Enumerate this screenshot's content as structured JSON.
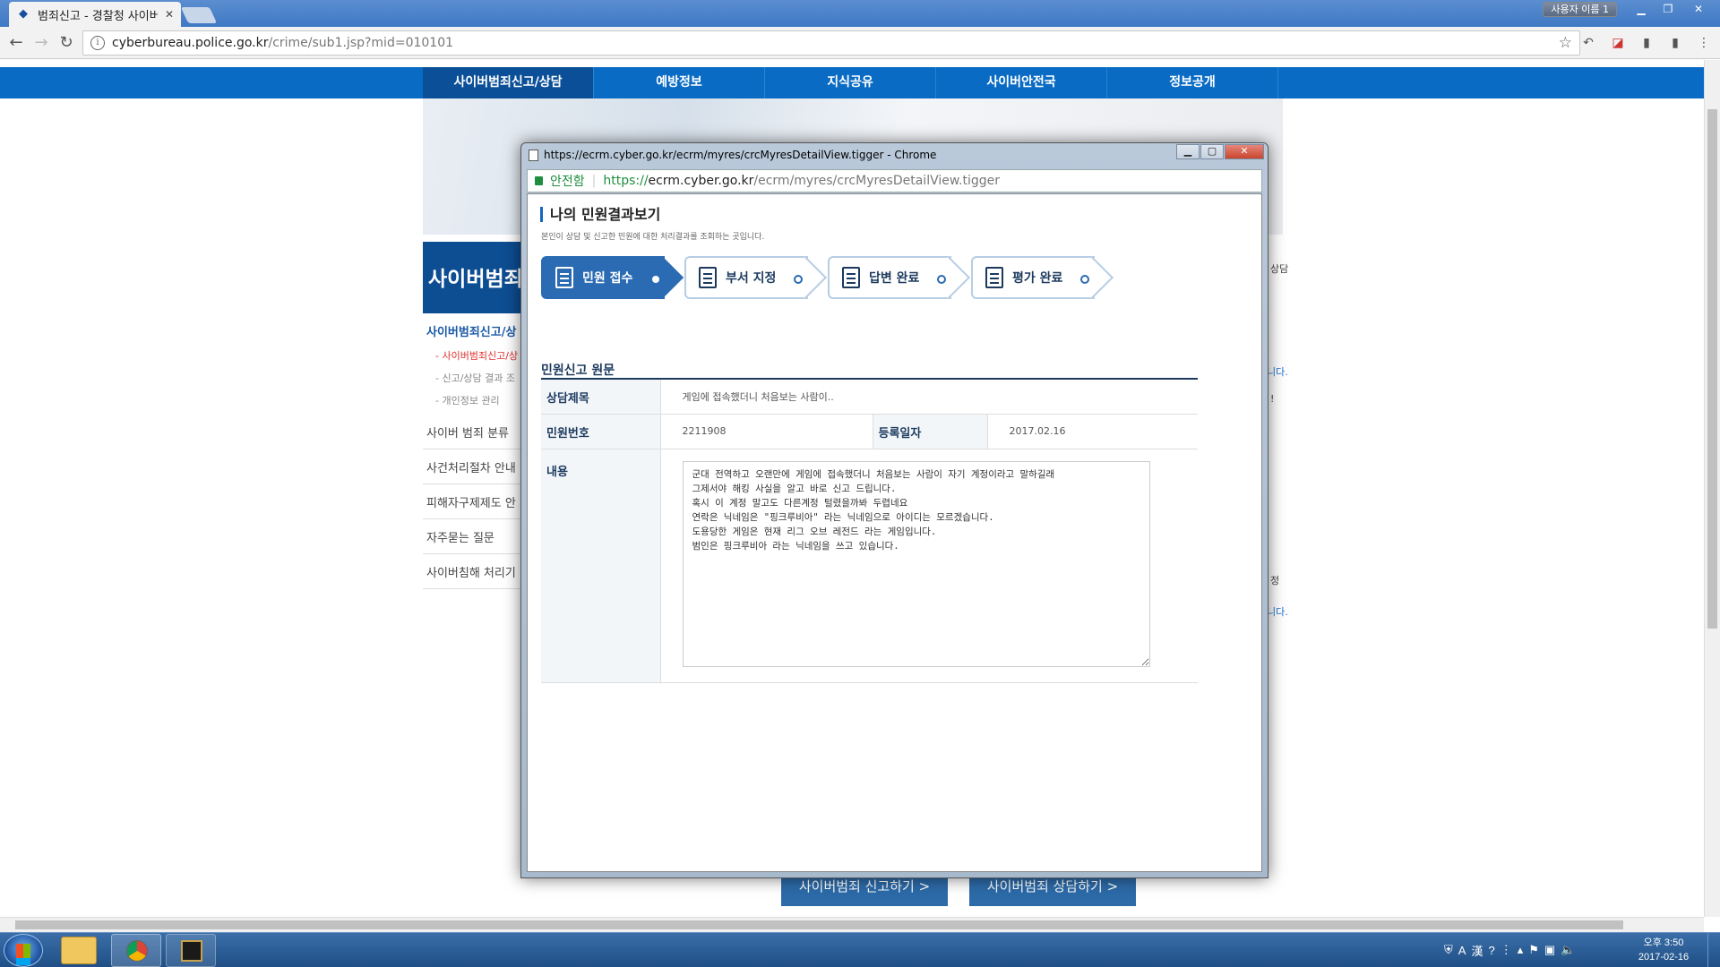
{
  "browser": {
    "tab_title": "범죄신고 - 경찰청 사이버",
    "user_badge": "사용자 이름 1",
    "url_host": "cyberbureau.police.go.kr",
    "url_path": "/crime/sub1.jsp?mid=010101"
  },
  "site": {
    "nav": [
      "사이버범죄신고/상담",
      "예방정보",
      "지식공유",
      "사이버안전국",
      "정보공개"
    ],
    "lnb_title": "사이버범죄",
    "lnb_sub": "사이버범죄신고/상",
    "lnb_links": [
      "- 사이버범죄신고/상",
      "- 신고/상담 결과 조",
      "- 개인정보 관리"
    ],
    "lnb_menu": [
      "사이버 범죄 분류",
      "사건처리절차 안내",
      "피해자구제제도 안",
      "자주묻는 질문",
      "사이버침해 처리기"
    ],
    "right_snips": [
      "상담",
      "니다.",
      "!",
      "정",
      "니다."
    ],
    "bottom_buttons": [
      "사이버범죄 신고하기 >",
      "사이버범죄 상담하기 >"
    ]
  },
  "popup": {
    "window_title": "https://ecrm.cyber.go.kr/ecrm/myres/crcMyresDetailView.tigger - Chrome",
    "secure_label": "안전함",
    "url_scheme": "https://",
    "url_host": "ecrm.cyber.go.kr",
    "url_path": "/ecrm/myres/crcMyresDetailView.tigger",
    "heading": "나의 민원결과보기",
    "description": "본인이 상담 및 신고한 민원에 대한 처리결과를 조회하는 곳입니다.",
    "steps": [
      {
        "label": "민원 접수",
        "active": true
      },
      {
        "label": "부서 지정",
        "active": false
      },
      {
        "label": "답변 완료",
        "active": false
      },
      {
        "label": "평가 완료",
        "active": false
      }
    ],
    "table_title": "민원신고 원문",
    "subject_label": "상담제목",
    "subject_value": "게임에 접속했더니 처음보는 사람이..",
    "complaint_no_label": "민원번호",
    "complaint_no_value": "2211908",
    "reg_date_label": "등록일자",
    "reg_date_value": "2017.02.16",
    "content_label": "내용",
    "content_value": "군대 전역하고 오랜만에 게임에 접속했더니 처음보는 사람이 자기 계정이라고 말하길래\n그제서야 해킹 사실을 알고 바로 신고 드립니다.\n혹시 이 계정 말고도 다른계정 털렸을까봐 두렵네요\n연락은 닉네임은 \"핑크루비아\" 라는 닉네임으로 아이디는 모르겠습니다.\n도용당한 게임은 현재 리그 오브 레전드 라는 게임입니다.\n범인은 핑크루비아 라는 닉네임을 쓰고 있습니다."
  },
  "taskbar": {
    "time": "오후 3:50",
    "date": "2017-02-16",
    "ime_a": "A",
    "ime_han": "漢"
  }
}
